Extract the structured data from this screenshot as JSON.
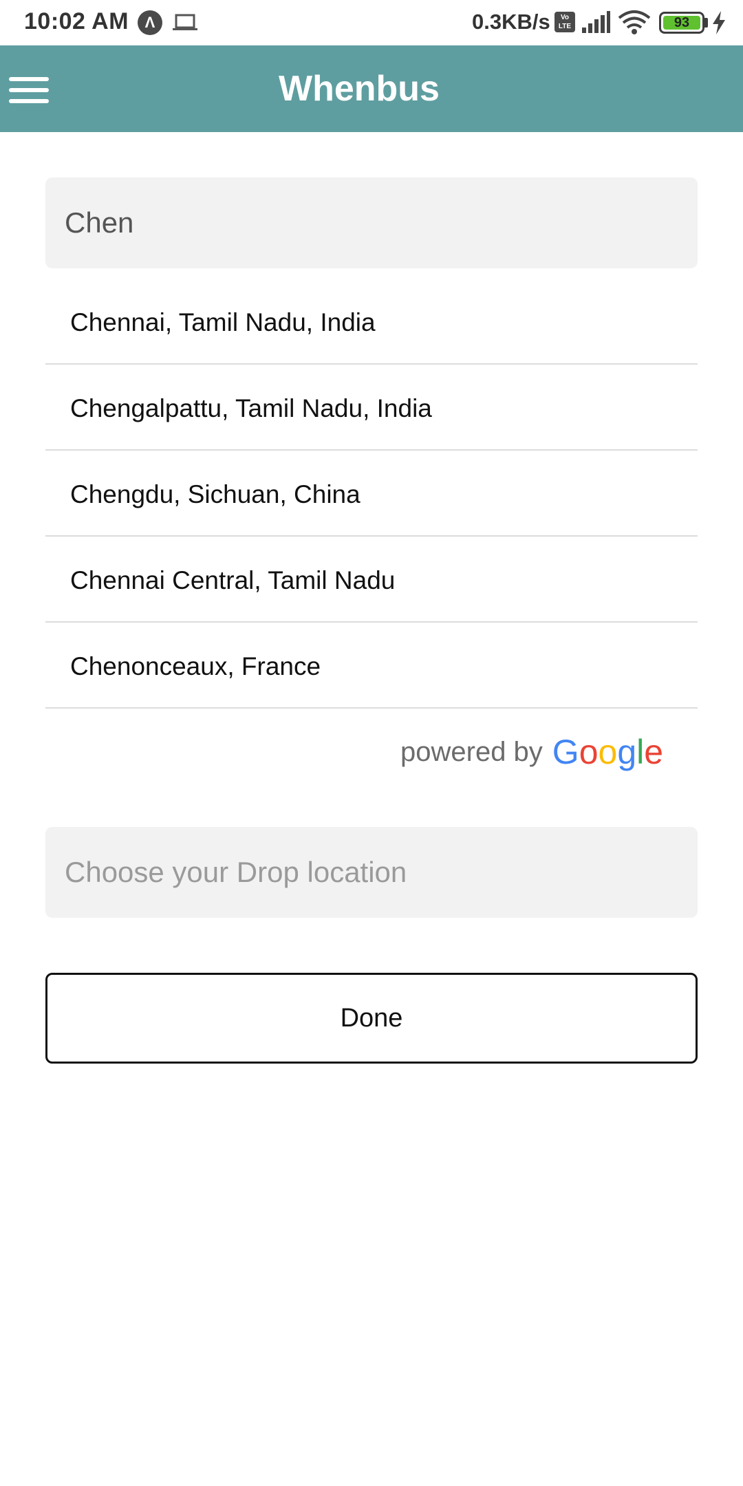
{
  "status_bar": {
    "time": "10:02 AM",
    "assistant_icon_glyph": "Λ",
    "net_speed": "0.3KB/s",
    "volte_label": "Vo LTE",
    "battery_level": "93",
    "icons": [
      "assistant-icon",
      "laptop-icon",
      "volte-icon",
      "signal-icon",
      "wifi-icon",
      "battery-icon",
      "charging-bolt-icon"
    ]
  },
  "app_bar": {
    "title": "Whenbus",
    "menu_icon": "hamburger-menu-icon",
    "background_color": "#5f9ea0"
  },
  "pickup": {
    "value": "Chen"
  },
  "suggestions": [
    "Chennai, Tamil Nadu, India",
    "Chengalpattu, Tamil Nadu, India",
    "Chengdu, Sichuan, China",
    "Chennai Central, Tamil Nadu",
    "Chenonceaux, France"
  ],
  "attribution": {
    "prefix": "powered by",
    "brand": "Google",
    "brand_letters": [
      "G",
      "o",
      "o",
      "g",
      "l",
      "e"
    ],
    "brand_colors": [
      "#4285F4",
      "#EA4335",
      "#FBBC05",
      "#4285F4",
      "#34A853",
      "#EA4335"
    ]
  },
  "drop": {
    "placeholder": "Choose your Drop location",
    "value": ""
  },
  "done_button": {
    "label": "Done"
  }
}
